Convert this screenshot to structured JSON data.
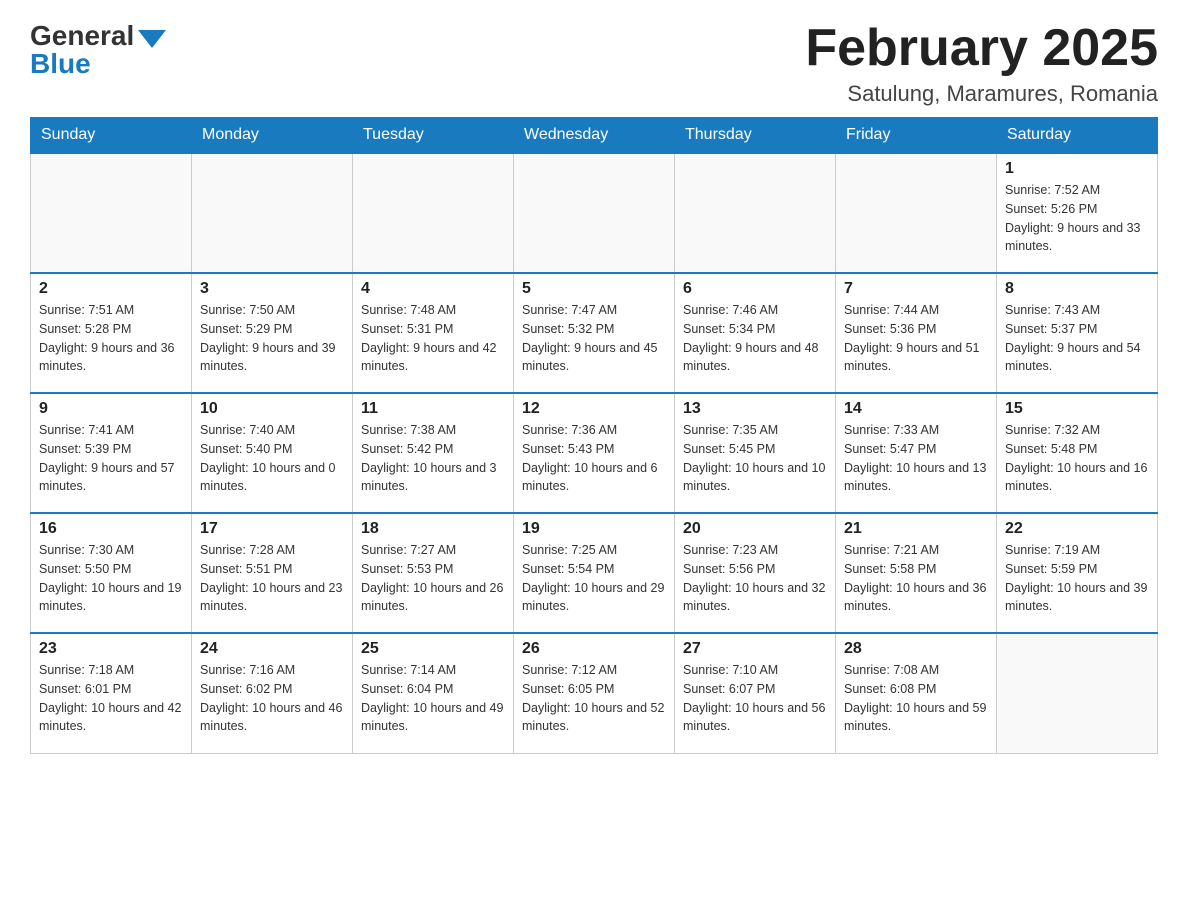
{
  "header": {
    "logo_general": "General",
    "logo_blue": "Blue",
    "month_title": "February 2025",
    "location": "Satulung, Maramures, Romania"
  },
  "days_of_week": [
    "Sunday",
    "Monday",
    "Tuesday",
    "Wednesday",
    "Thursday",
    "Friday",
    "Saturday"
  ],
  "weeks": [
    [
      {
        "day": "",
        "info": ""
      },
      {
        "day": "",
        "info": ""
      },
      {
        "day": "",
        "info": ""
      },
      {
        "day": "",
        "info": ""
      },
      {
        "day": "",
        "info": ""
      },
      {
        "day": "",
        "info": ""
      },
      {
        "day": "1",
        "info": "Sunrise: 7:52 AM\nSunset: 5:26 PM\nDaylight: 9 hours and 33 minutes."
      }
    ],
    [
      {
        "day": "2",
        "info": "Sunrise: 7:51 AM\nSunset: 5:28 PM\nDaylight: 9 hours and 36 minutes."
      },
      {
        "day": "3",
        "info": "Sunrise: 7:50 AM\nSunset: 5:29 PM\nDaylight: 9 hours and 39 minutes."
      },
      {
        "day": "4",
        "info": "Sunrise: 7:48 AM\nSunset: 5:31 PM\nDaylight: 9 hours and 42 minutes."
      },
      {
        "day": "5",
        "info": "Sunrise: 7:47 AM\nSunset: 5:32 PM\nDaylight: 9 hours and 45 minutes."
      },
      {
        "day": "6",
        "info": "Sunrise: 7:46 AM\nSunset: 5:34 PM\nDaylight: 9 hours and 48 minutes."
      },
      {
        "day": "7",
        "info": "Sunrise: 7:44 AM\nSunset: 5:36 PM\nDaylight: 9 hours and 51 minutes."
      },
      {
        "day": "8",
        "info": "Sunrise: 7:43 AM\nSunset: 5:37 PM\nDaylight: 9 hours and 54 minutes."
      }
    ],
    [
      {
        "day": "9",
        "info": "Sunrise: 7:41 AM\nSunset: 5:39 PM\nDaylight: 9 hours and 57 minutes."
      },
      {
        "day": "10",
        "info": "Sunrise: 7:40 AM\nSunset: 5:40 PM\nDaylight: 10 hours and 0 minutes."
      },
      {
        "day": "11",
        "info": "Sunrise: 7:38 AM\nSunset: 5:42 PM\nDaylight: 10 hours and 3 minutes."
      },
      {
        "day": "12",
        "info": "Sunrise: 7:36 AM\nSunset: 5:43 PM\nDaylight: 10 hours and 6 minutes."
      },
      {
        "day": "13",
        "info": "Sunrise: 7:35 AM\nSunset: 5:45 PM\nDaylight: 10 hours and 10 minutes."
      },
      {
        "day": "14",
        "info": "Sunrise: 7:33 AM\nSunset: 5:47 PM\nDaylight: 10 hours and 13 minutes."
      },
      {
        "day": "15",
        "info": "Sunrise: 7:32 AM\nSunset: 5:48 PM\nDaylight: 10 hours and 16 minutes."
      }
    ],
    [
      {
        "day": "16",
        "info": "Sunrise: 7:30 AM\nSunset: 5:50 PM\nDaylight: 10 hours and 19 minutes."
      },
      {
        "day": "17",
        "info": "Sunrise: 7:28 AM\nSunset: 5:51 PM\nDaylight: 10 hours and 23 minutes."
      },
      {
        "day": "18",
        "info": "Sunrise: 7:27 AM\nSunset: 5:53 PM\nDaylight: 10 hours and 26 minutes."
      },
      {
        "day": "19",
        "info": "Sunrise: 7:25 AM\nSunset: 5:54 PM\nDaylight: 10 hours and 29 minutes."
      },
      {
        "day": "20",
        "info": "Sunrise: 7:23 AM\nSunset: 5:56 PM\nDaylight: 10 hours and 32 minutes."
      },
      {
        "day": "21",
        "info": "Sunrise: 7:21 AM\nSunset: 5:58 PM\nDaylight: 10 hours and 36 minutes."
      },
      {
        "day": "22",
        "info": "Sunrise: 7:19 AM\nSunset: 5:59 PM\nDaylight: 10 hours and 39 minutes."
      }
    ],
    [
      {
        "day": "23",
        "info": "Sunrise: 7:18 AM\nSunset: 6:01 PM\nDaylight: 10 hours and 42 minutes."
      },
      {
        "day": "24",
        "info": "Sunrise: 7:16 AM\nSunset: 6:02 PM\nDaylight: 10 hours and 46 minutes."
      },
      {
        "day": "25",
        "info": "Sunrise: 7:14 AM\nSunset: 6:04 PM\nDaylight: 10 hours and 49 minutes."
      },
      {
        "day": "26",
        "info": "Sunrise: 7:12 AM\nSunset: 6:05 PM\nDaylight: 10 hours and 52 minutes."
      },
      {
        "day": "27",
        "info": "Sunrise: 7:10 AM\nSunset: 6:07 PM\nDaylight: 10 hours and 56 minutes."
      },
      {
        "day": "28",
        "info": "Sunrise: 7:08 AM\nSunset: 6:08 PM\nDaylight: 10 hours and 59 minutes."
      },
      {
        "day": "",
        "info": ""
      }
    ]
  ]
}
